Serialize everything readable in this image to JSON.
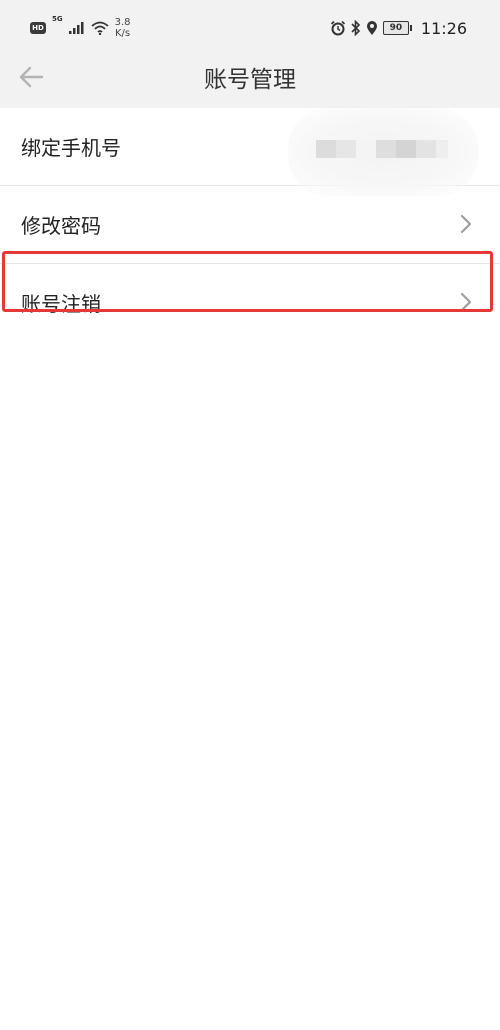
{
  "status_bar": {
    "hd_badge": "HD",
    "network_type": "5G",
    "speed_value": "3.8",
    "speed_unit": "K/s",
    "battery": "90",
    "time": "11:26",
    "icons": [
      "hd-icon",
      "signal-icon",
      "wifi-icon",
      "alarm-icon",
      "bluetooth-icon",
      "location-icon",
      "battery-icon"
    ]
  },
  "header": {
    "title": "账号管理",
    "back_icon": "arrow-left-icon"
  },
  "settings": {
    "items": [
      {
        "label": "绑定手机号"
      },
      {
        "label": "修改密码"
      },
      {
        "label": "账号注销"
      }
    ]
  },
  "colors": {
    "header_bg": "#f2f2f2",
    "highlight": "#e53935",
    "text": "#222222",
    "divider": "#e6e6e6"
  }
}
